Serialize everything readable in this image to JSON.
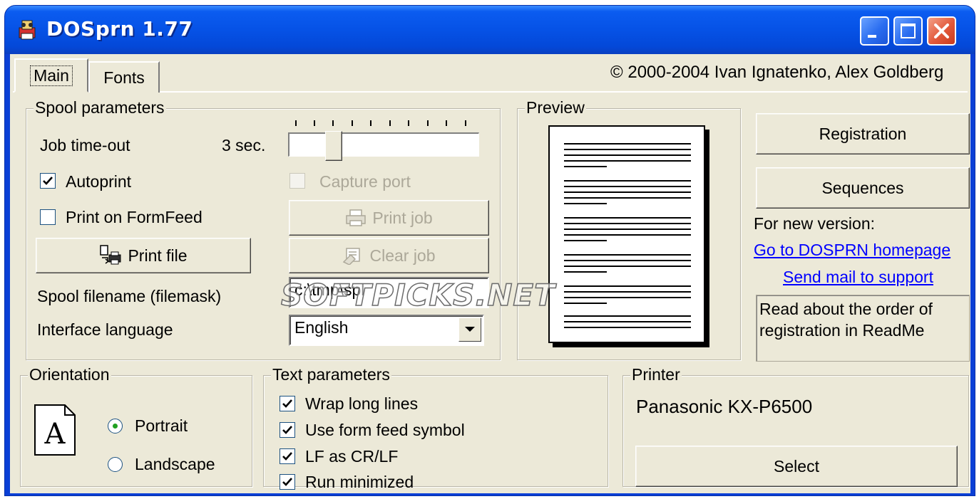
{
  "window": {
    "title": "DOSprn 1.77",
    "copyright": "© 2000-2004 Ivan Ignatenko, Alex Goldberg"
  },
  "tabs": [
    {
      "label": "Main",
      "selected": true
    },
    {
      "label": "Fonts",
      "selected": false
    }
  ],
  "spool": {
    "group_title": "Spool parameters",
    "job_timeout_label": "Job time-out",
    "job_timeout_value": "3 sec.",
    "autoprint_label": "Autoprint",
    "autoprint_checked": true,
    "capture_port_label": "Capture port",
    "capture_port_checked": false,
    "print_on_formfeed_label": "Print on FormFeed",
    "print_on_formfeed_checked": false,
    "print_job_label": "Print job",
    "print_file_label": "Print file",
    "clear_job_label": "Clear job",
    "spool_filename_label": "Spool filename (filemask)",
    "spool_filename_value": "c:\\tmp\\spl",
    "interface_language_label": "Interface language",
    "interface_language_value": "English"
  },
  "preview": {
    "group_title": "Preview"
  },
  "side": {
    "registration_label": "Registration",
    "sequences_label": "Sequences",
    "new_version_label": "For new version:",
    "homepage_link": "Go to DOSPRN homepage",
    "mail_link": "Send mail to support",
    "info_text": "Read about the order of registration in ReadMe"
  },
  "orientation": {
    "group_title": "Orientation",
    "portrait_label": "Portrait",
    "landscape_label": "Landscape",
    "selected": "Portrait",
    "icon_letter": "A"
  },
  "text_params": {
    "group_title": "Text parameters",
    "options": [
      {
        "label": "Wrap long lines",
        "checked": true
      },
      {
        "label": "Use form feed symbol",
        "checked": true
      },
      {
        "label": "LF as CR/LF",
        "checked": true
      },
      {
        "label": "Run minimized",
        "checked": true
      }
    ]
  },
  "printer": {
    "group_title": "Printer",
    "name": "Panasonic KX-P6500",
    "select_label": "Select"
  },
  "watermark": "SOFTPICKS.NET"
}
